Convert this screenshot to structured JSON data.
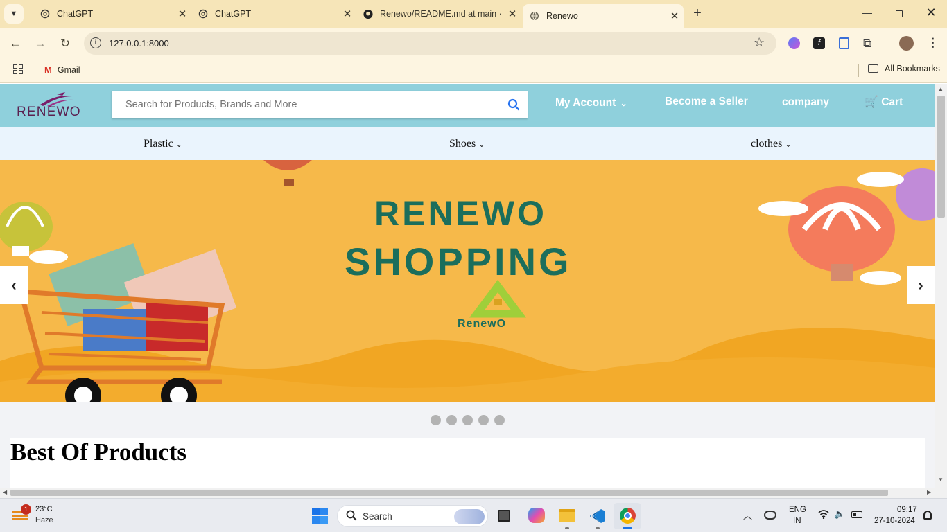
{
  "browser": {
    "tabs": [
      {
        "title": "ChatGPT",
        "icon": "chatgpt-icon"
      },
      {
        "title": "ChatGPT",
        "icon": "chatgpt-icon"
      },
      {
        "title": "Renewo/README.md at main · ",
        "icon": "github-icon"
      },
      {
        "title": "Renewo",
        "icon": "globe-icon"
      }
    ],
    "url": "127.0.0.1:8000",
    "bookmarks": {
      "gmail": "Gmail",
      "all": "All Bookmarks"
    }
  },
  "site": {
    "logo": "RENEWO",
    "search_placeholder": "Search for Products, Brands and More",
    "nav": {
      "account": "My Account",
      "seller": "Become a Seller",
      "company": "company",
      "cart": "Cart"
    },
    "categories": [
      "Plastic",
      "Shoes",
      "clothes"
    ],
    "banner": {
      "title_line1": "RENEWO",
      "title_line2": "SHOPPING",
      "badge": "RenewO"
    },
    "carousel": {
      "prev": "‹",
      "next": "›",
      "slides": 5
    },
    "section_title": "Best Of Products"
  },
  "taskbar": {
    "weather_temp": "23°C",
    "weather_desc": "Haze",
    "weather_badge": "1",
    "search": "Search",
    "lang1": "ENG",
    "lang2": "IN",
    "time": "09:17",
    "date": "27-10-2024"
  }
}
